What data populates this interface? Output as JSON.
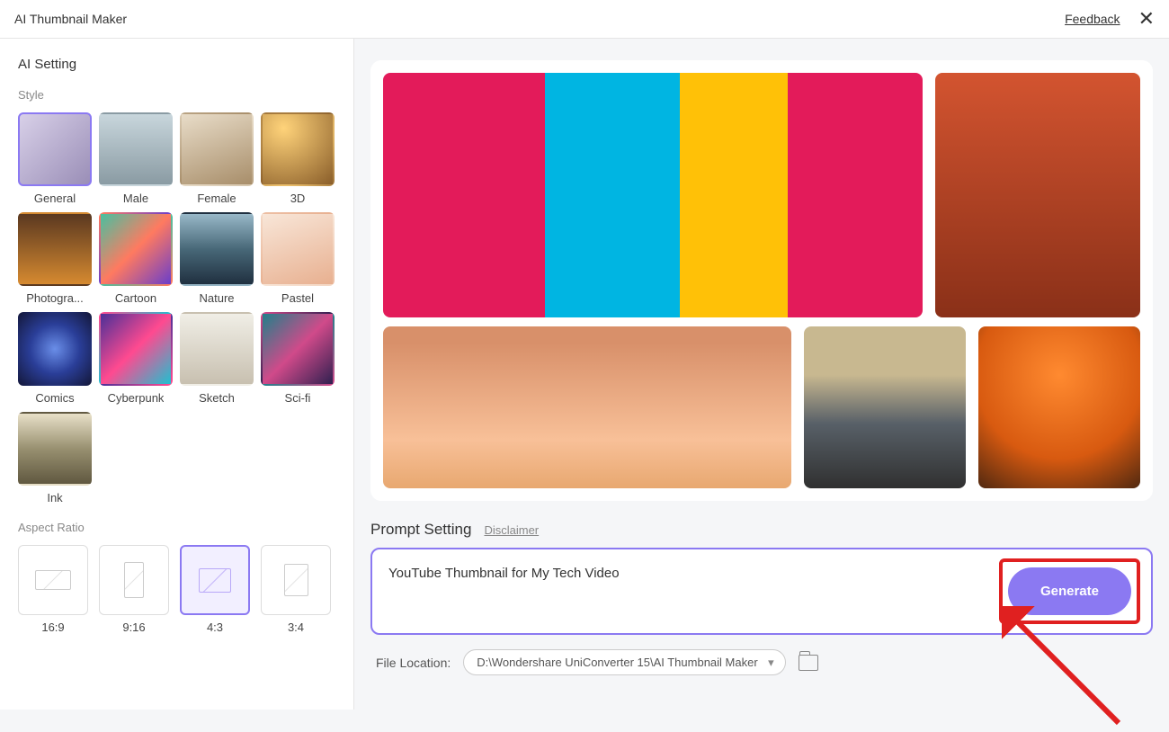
{
  "titlebar": {
    "title": "AI Thumbnail Maker",
    "feedback": "Feedback"
  },
  "sidebar": {
    "section_title": "AI Setting",
    "style_label": "Style",
    "aspect_ratio_label": "Aspect Ratio",
    "styles": [
      {
        "label": "General",
        "cls": "th-general",
        "selected": true
      },
      {
        "label": "Male",
        "cls": "th-male"
      },
      {
        "label": "Female",
        "cls": "th-female"
      },
      {
        "label": "3D",
        "cls": "th-3d"
      },
      {
        "label": "Photogra...",
        "cls": "th-photogra"
      },
      {
        "label": "Cartoon",
        "cls": "th-cartoon"
      },
      {
        "label": "Nature",
        "cls": "th-nature"
      },
      {
        "label": "Pastel",
        "cls": "th-pastel"
      },
      {
        "label": "Comics",
        "cls": "th-comics"
      },
      {
        "label": "Cyberpunk",
        "cls": "th-cyberpunk"
      },
      {
        "label": "Sketch",
        "cls": "th-sketch"
      },
      {
        "label": "Sci-fi",
        "cls": "th-scifi"
      },
      {
        "label": "Ink",
        "cls": "th-ink"
      }
    ],
    "ratios": [
      {
        "label": "16:9",
        "cls": "r-16-9"
      },
      {
        "label": "9:16",
        "cls": "r-9-16"
      },
      {
        "label": "4:3",
        "cls": "r-4-3",
        "selected": true
      },
      {
        "label": "3:4",
        "cls": "r-3-4"
      }
    ]
  },
  "prompt": {
    "title": "Prompt Setting",
    "disclaimer": "Disclaimer",
    "value": "YouTube Thumbnail for My Tech Video",
    "generate": "Generate"
  },
  "bottom": {
    "file_location_label": "File Location:",
    "path": "D:\\Wondershare UniConverter 15\\AI Thumbnail Maker"
  }
}
